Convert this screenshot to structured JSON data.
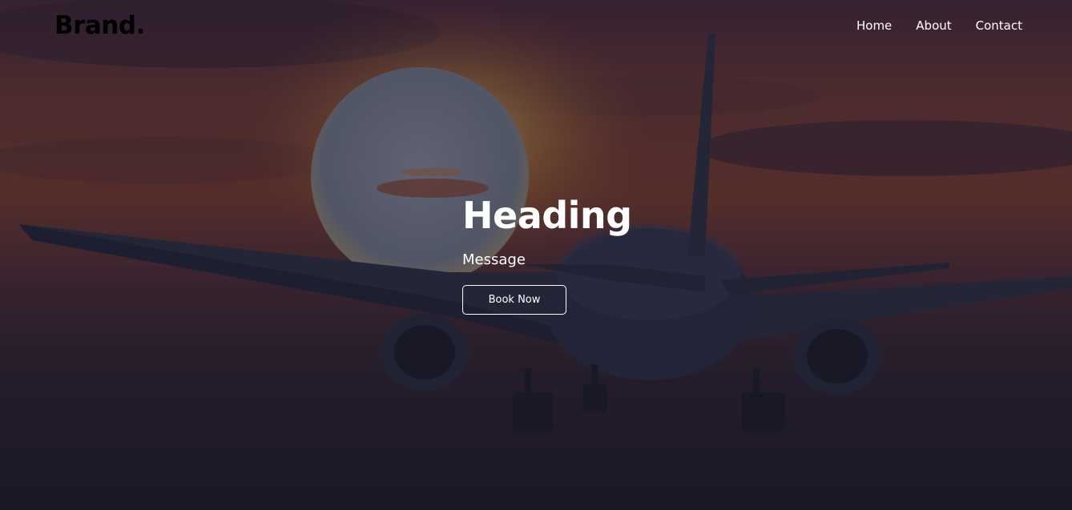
{
  "brand": {
    "label": "Brand."
  },
  "nav": {
    "items": [
      {
        "label": "Home"
      },
      {
        "label": "About"
      },
      {
        "label": "Contact"
      }
    ]
  },
  "hero": {
    "heading": "Heading",
    "message": "Message",
    "button_label": "Book Now",
    "background_image": "airplane-sunset-photo"
  },
  "colors": {
    "brand_text": "#000000",
    "nav_text": "#ffffff",
    "hero_text": "#ffffff",
    "button_border": "#ffffff"
  }
}
